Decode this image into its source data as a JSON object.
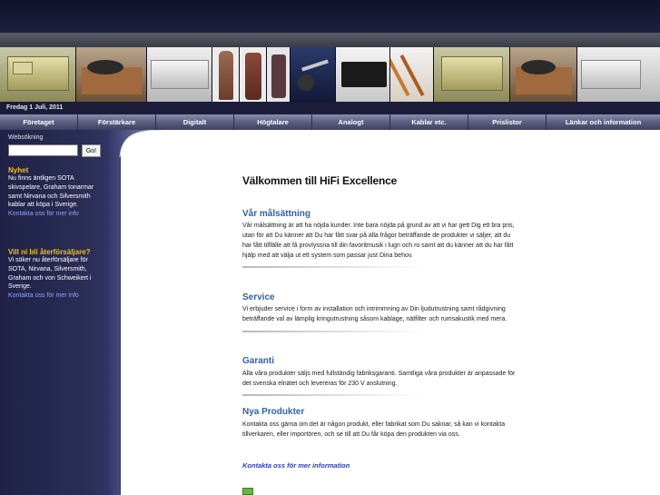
{
  "date_bar": "Fredag 1 Juli, 2011",
  "nav": [
    "Företaget",
    "Förstärkare",
    "Digitalt",
    "Högtalare",
    "Analogt",
    "Kablar etc.",
    "Prislistor",
    "Länkar och information"
  ],
  "sidebar": {
    "search_label": "Websökning",
    "search_value": "",
    "search_button": "Go!",
    "news_heading": "Nyhet",
    "news_lines": [
      "Nu finns äntligen SOTA",
      "skivspelare, Graham tonarmar",
      "samt Nirvana och Silversmith",
      "kablar att köpa i Sverige."
    ],
    "news_link": "Kontakta oss för mer info",
    "reseller_heading": "Vill ni bli återförsäljare?",
    "reseller_lines": [
      "Vi söker nu återförsäljare för",
      "SOTA, Nirvana, Silversmith,",
      "Graham och von Schweikert i",
      "Sverige."
    ],
    "reseller_link": "Kontakta oss för mer info"
  },
  "main": {
    "welcome": "Välkommen till HiFi Excellence",
    "sections": [
      {
        "title": "Vår målsättning",
        "lines": [
          "Vår målsättning är att ha nöjda kunder. Inte bara nöjda på grund av att vi har gett Dig ett bra pris,",
          "utan för att Du känner att Du har fått svar på alla frågor beträffande de produkter vi säljer, att du",
          "har fått tillfälle att få provlyssna till din favoritmusik i lugn och ro samt att du känner att du har fått",
          "hjälp med att välja ut ett system som passar just Dina behov."
        ]
      },
      {
        "title": "Service",
        "lines": [
          "Vi erbjuder service i form av installation och intrimmning av Din ljudutrustning samt rådgivning",
          "beträffande val av lämplig kringutrustning såsom kablage, nätfilter och rumsakustik med mera."
        ]
      },
      {
        "title": "Garanti",
        "lines": [
          "Alla våra produkter säljs med fullständig fabriksgaranti. Samtliga våra produkter är anpassade för",
          "det svenska elnätet och levereras för 230 V anslutning."
        ]
      },
      {
        "title": "Nya Produkter",
        "lines": [
          "Kontakta oss gärna om det är någon produkt, eller fabrikat som Du saknar, så kan vi kontakta",
          "tillverkaren, eller importören, och se till att Du får köpa den produkten via oss."
        ]
      }
    ],
    "contact_link": "Kontakta oss för mer information"
  }
}
